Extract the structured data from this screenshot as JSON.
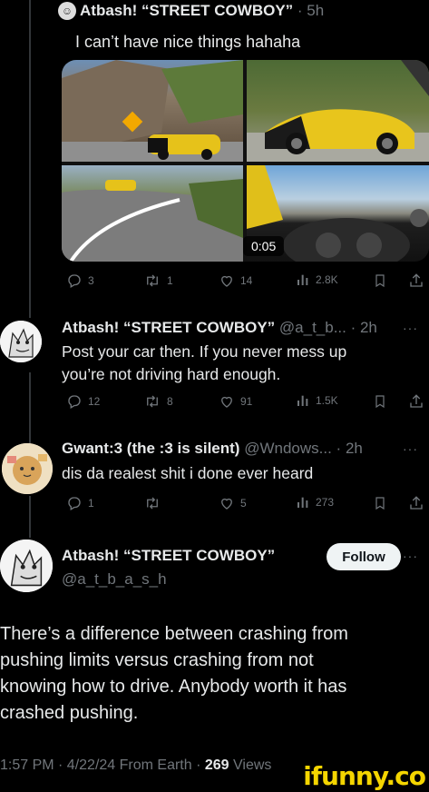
{
  "tweet1": {
    "name": "Atbash! “STREET COWBOY”",
    "time": "· 5h",
    "text": "I can’t have nice things hahaha",
    "video_duration": "0:05",
    "replies": "3",
    "retweets": "1",
    "likes": "14",
    "views": "2.8K"
  },
  "reply1": {
    "name": "Atbash! “STREET COWBOY”",
    "handle_time": "@a_t_b... · 2h",
    "text_line1": "Post your car then. If you never mess up",
    "text_line2": "you’re not driving hard enough.",
    "replies": "12",
    "retweets": "8",
    "likes": "91",
    "views": "1.5K"
  },
  "reply2": {
    "name": "Gwant:3 (the :3 is silent)",
    "handle_time": "@Wndows... · 2h",
    "text": "dis da realest shit i done ever heard",
    "replies": "1",
    "retweets": "",
    "likes": "5",
    "views": "273"
  },
  "main": {
    "name": "Atbash! “STREET COWBOY”",
    "handle": "@a_t_b_a_s_h",
    "follow_label": "Follow",
    "text_lines": [
      "There’s a difference between crashing from",
      "pushing limits versus crashing from not",
      "knowing how to drive. Anybody worth it has",
      "crashed pushing."
    ],
    "footer_meta": "1:57 PM · 4/22/24 From Earth ·",
    "footer_views_count": "269",
    "footer_views_label": "Views"
  },
  "watermark": "ifunny.co",
  "more_glyph": "···",
  "colors": {
    "background": "#000000",
    "text": "#e7e9ea",
    "muted": "#71767b",
    "line": "#333639",
    "watermark": "#f4d500"
  },
  "icons": [
    "reply-icon",
    "retweet-icon",
    "like-icon",
    "views-icon",
    "bookmark-icon",
    "share-icon",
    "more-icon"
  ]
}
